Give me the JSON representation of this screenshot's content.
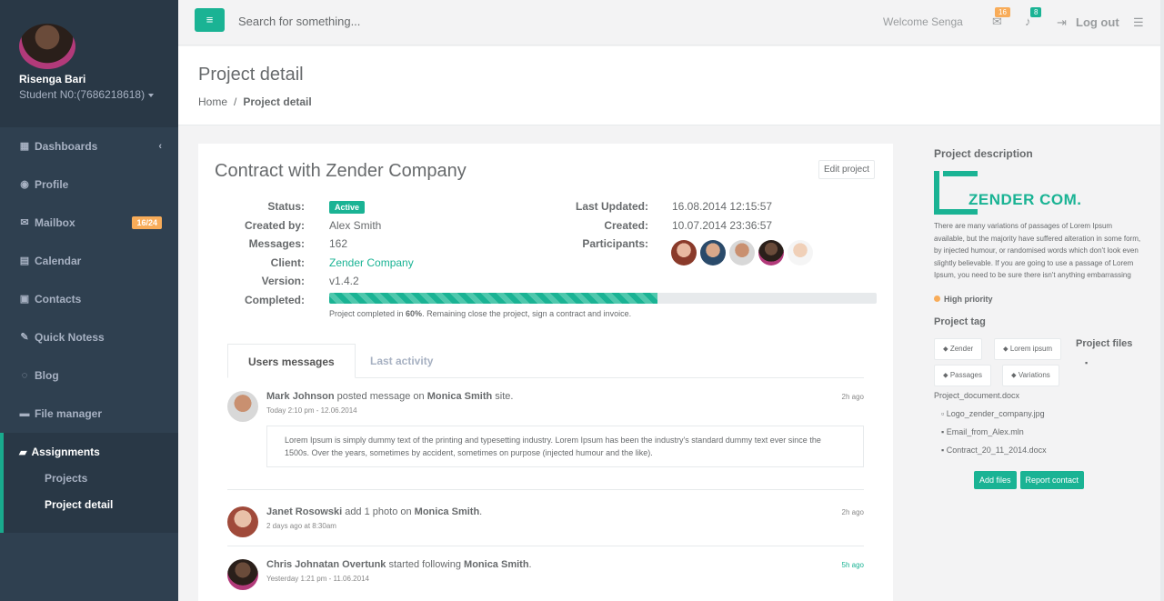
{
  "profile": {
    "name": "Risenga Bari",
    "student_no": "Student N0:(7686218618)"
  },
  "nav": [
    {
      "label": "Dashboards",
      "icon": "th-large-icon"
    },
    {
      "label": "Profile",
      "icon": "user-icon"
    },
    {
      "label": "Mailbox",
      "icon": "envelope-icon",
      "badge": "16/24"
    },
    {
      "label": "Calendar",
      "icon": "calendar-icon"
    },
    {
      "label": "Contacts",
      "icon": "address-book-icon"
    },
    {
      "label": "Quick Notess",
      "icon": "edit-icon"
    },
    {
      "label": "Blog",
      "icon": "comments-icon"
    },
    {
      "label": "File manager",
      "icon": "files-icon"
    }
  ],
  "nav_active": {
    "label": "Assignments",
    "sub": [
      "Projects",
      "Project detail"
    ]
  },
  "topbar": {
    "search_placeholder": "Search for something...",
    "welcome": "Welcome Senga",
    "mail_count": "16",
    "bell_count": "8",
    "logout": "Log out"
  },
  "heading": {
    "title": "Project detail",
    "crumb_home": "Home",
    "crumb_sep": "/",
    "crumb_current": "Project detail"
  },
  "project": {
    "title": "Contract with Zender Company",
    "edit_label": "Edit project",
    "status_label": "Status:",
    "status": "Active",
    "created_by_label": "Created by:",
    "created_by": "Alex Smith",
    "messages_label": "Messages:",
    "messages": "162",
    "client_label": "Client:",
    "client": "Zender Company",
    "version_label": "Version:",
    "version": "v1.4.2",
    "completed_label": "Completed:",
    "completed_pct": 60,
    "completed_note_pre": "Project completed in ",
    "completed_note_pct": "60%",
    "completed_note_post": ". Remaining close the project, sign a contract and invoice.",
    "last_updated_label": "Last Updated:",
    "last_updated": "16.08.2014 12:15:57",
    "created_label": "Created:",
    "created": "10.07.2014 23:36:57",
    "participants_label": "Participants:"
  },
  "tabs": {
    "active": "Users messages",
    "inactive": "Last activity"
  },
  "feed": [
    {
      "name": "Mark Johnson",
      "action": " posted message on ",
      "target": "Monica Smith",
      "tail": " site.",
      "sub": "Today 2:10 pm - 12.06.2014",
      "time": "2h ago",
      "text": "Lorem Ipsum is simply dummy text of the printing and typesetting industry. Lorem Ipsum has been the industry's standard dummy text ever since the 1500s. Over the years, sometimes by accident, sometimes on purpose (injected humour and the like)."
    },
    {
      "name": "Janet Rosowski",
      "action": " add 1 photo on ",
      "target": "Monica Smith",
      "tail": ".",
      "sub": "2 days ago at 8:30am",
      "time": "2h ago"
    },
    {
      "name": "Chris Johnatan Overtunk",
      "action": " started following ",
      "target": "Monica Smith",
      "tail": ".",
      "sub": "Yesterday 1:21 pm - 11.06.2014",
      "time": "5h ago"
    }
  ],
  "right": {
    "desc_title": "Project description",
    "logo_text": "ZENDER COM.",
    "description": "There are many variations of passages of Lorem Ipsum available, but the majority have suffered alteration in some form, by injected humour, or randomised words which don't look even slightly believable. If you are going to use a passage of Lorem Ipsum, you need to be sure there isn't anything embarrassing",
    "priority": "High priority",
    "tag_title": "Project tag",
    "tags": [
      "Zender",
      "Lorem ipsum",
      "Passages",
      "Variations"
    ],
    "files_title": "Project files",
    "files": [
      "Project_document.docx",
      "Logo_zender_company.jpg",
      "Email_from_Alex.mln",
      "Contract_20_11_2014.docx"
    ],
    "add_files": "Add files",
    "report": "Report contact"
  },
  "colors": {
    "accent": "#1ab394",
    "sidebar": "#2f4050",
    "badge": "#f8ac59"
  }
}
